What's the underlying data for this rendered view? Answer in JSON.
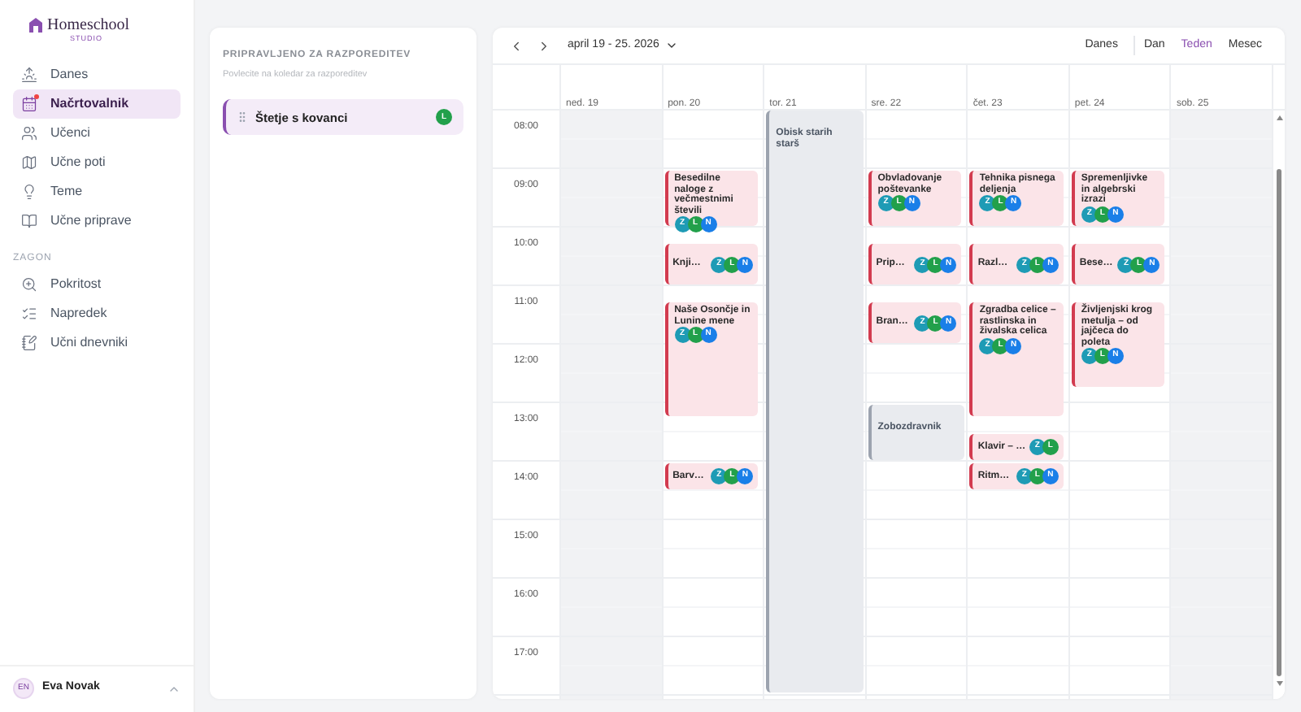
{
  "sidebar": {
    "logo": {
      "name": "Homeschool",
      "tagline": "STUDIO"
    },
    "items": [
      {
        "label": "Danes",
        "selected": false,
        "badge": false
      },
      {
        "label": "Načrtovalnik",
        "selected": true,
        "badge": true
      },
      {
        "label": "Učenci",
        "selected": false,
        "badge": false
      },
      {
        "label": "Učne poti",
        "selected": false,
        "badge": false
      },
      {
        "label": "Teme",
        "selected": false,
        "badge": false
      },
      {
        "label": "Učne priprave",
        "selected": false,
        "badge": false
      }
    ],
    "section": "ZAGON",
    "section_items": [
      {
        "label": "Pokritost",
        "selected": false,
        "badge": false
      },
      {
        "label": "Napredek",
        "selected": false,
        "badge": false
      },
      {
        "label": "Učni dnevniki",
        "selected": false,
        "badge": false
      }
    ],
    "user": {
      "initials": "EN",
      "name": "Eva Novak"
    }
  },
  "backlog": {
    "title": "PRIPRAVLJENO ZA RAZPOREDITEV",
    "hint": "Povlecite na koledar za razporeditev",
    "items": [
      {
        "title": "Štetje s kovanci",
        "students": [
          {
            "letter": "L",
            "color": "#22a04b"
          }
        ]
      }
    ]
  },
  "calendar": {
    "range": "april 19 - 25. 2026",
    "views": [
      {
        "label": "Danes",
        "selected": false
      },
      {
        "label": "Dan",
        "selected": false
      },
      {
        "label": "Teden",
        "selected": true
      },
      {
        "label": "Mesec",
        "selected": false
      }
    ],
    "hours": [
      "08:00",
      "09:00",
      "10:00",
      "11:00",
      "12:00",
      "13:00",
      "14:00",
      "15:00",
      "16:00",
      "17:00"
    ],
    "days": [
      {
        "label": "ned. 19",
        "weekend": true
      },
      {
        "label": "pon. 20",
        "weekend": false,
        "events": [
          {
            "kind": "lesson",
            "title": "Besedilne naloge z večmestnimi števili",
            "students": [
              {
                "letter": "Z",
                "color": "#1e9bb5"
              },
              {
                "letter": "L",
                "color": "#22a04b"
              },
              {
                "letter": "N",
                "color": "#1a7fe8"
              }
            ]
          },
          {
            "kind": "lesson",
            "title": "Knji…",
            "students": [
              {
                "letter": "Z",
                "color": "#1e9bb5"
              },
              {
                "letter": "L",
                "color": "#22a04b"
              },
              {
                "letter": "N",
                "color": "#1a7fe8"
              }
            ]
          },
          {
            "kind": "lesson",
            "title": "Naše Osončje in Lunine mene",
            "students": [
              {
                "letter": "Z",
                "color": "#1e9bb5"
              },
              {
                "letter": "L",
                "color": "#22a04b"
              },
              {
                "letter": "N",
                "color": "#1a7fe8"
              }
            ]
          },
          {
            "kind": "lesson",
            "title": "Barv…",
            "students": [
              {
                "letter": "Z",
                "color": "#1e9bb5"
              },
              {
                "letter": "L",
                "color": "#22a04b"
              },
              {
                "letter": "N",
                "color": "#1a7fe8"
              }
            ]
          }
        ]
      },
      {
        "label": "tor. 21",
        "weekend": false,
        "events": [
          {
            "kind": "personal",
            "title": "Obisk starih starš"
          }
        ]
      },
      {
        "label": "sre. 22",
        "weekend": false,
        "events": [
          {
            "kind": "lesson",
            "title": "Obvladovanje poštevanke",
            "students": [
              {
                "letter": "Z",
                "color": "#1e9bb5"
              },
              {
                "letter": "L",
                "color": "#22a04b"
              },
              {
                "letter": "N",
                "color": "#1a7fe8"
              }
            ]
          },
          {
            "kind": "lesson",
            "title": "Prip…",
            "students": [
              {
                "letter": "Z",
                "color": "#1e9bb5"
              },
              {
                "letter": "L",
                "color": "#22a04b"
              },
              {
                "letter": "N",
                "color": "#1a7fe8"
              }
            ]
          },
          {
            "kind": "lesson",
            "title": "Bran…",
            "students": [
              {
                "letter": "Z",
                "color": "#1e9bb5"
              },
              {
                "letter": "L",
                "color": "#22a04b"
              },
              {
                "letter": "N",
                "color": "#1a7fe8"
              }
            ]
          },
          {
            "kind": "personal",
            "title": "Zobozdravnik"
          }
        ]
      },
      {
        "label": "čet. 23",
        "weekend": false,
        "events": [
          {
            "kind": "lesson",
            "title": "Tehnika pisnega deljenja",
            "students": [
              {
                "letter": "Z",
                "color": "#1e9bb5"
              },
              {
                "letter": "L",
                "color": "#22a04b"
              },
              {
                "letter": "N",
                "color": "#1a7fe8"
              }
            ]
          },
          {
            "kind": "lesson",
            "title": "Razl…",
            "students": [
              {
                "letter": "Z",
                "color": "#1e9bb5"
              },
              {
                "letter": "L",
                "color": "#22a04b"
              },
              {
                "letter": "N",
                "color": "#1a7fe8"
              }
            ]
          },
          {
            "kind": "lesson",
            "title": "Zgradba celice – rastlinska in živalska celica",
            "students": [
              {
                "letter": "Z",
                "color": "#1e9bb5"
              },
              {
                "letter": "L",
                "color": "#22a04b"
              },
              {
                "letter": "N",
                "color": "#1a7fe8"
              }
            ]
          },
          {
            "kind": "lesson",
            "title": "Klavir – …",
            "students": [
              {
                "letter": "Z",
                "color": "#1e9bb5"
              },
              {
                "letter": "L",
                "color": "#22a04b"
              }
            ]
          },
          {
            "kind": "lesson",
            "title": "Ritm…",
            "students": [
              {
                "letter": "Z",
                "color": "#1e9bb5"
              },
              {
                "letter": "L",
                "color": "#22a04b"
              },
              {
                "letter": "N",
                "color": "#1a7fe8"
              }
            ]
          }
        ]
      },
      {
        "label": "pet. 24",
        "weekend": false,
        "events": [
          {
            "kind": "lesson",
            "title": "Spremenljivke in algebrski izrazi",
            "students": [
              {
                "letter": "Z",
                "color": "#1e9bb5"
              },
              {
                "letter": "L",
                "color": "#22a04b"
              },
              {
                "letter": "N",
                "color": "#1a7fe8"
              }
            ]
          },
          {
            "kind": "lesson",
            "title": "Bese…",
            "students": [
              {
                "letter": "Z",
                "color": "#1e9bb5"
              },
              {
                "letter": "L",
                "color": "#22a04b"
              },
              {
                "letter": "N",
                "color": "#1a7fe8"
              }
            ]
          },
          {
            "kind": "lesson",
            "title": "Življenjski krog metulja – od jajčeca do poleta",
            "students": [
              {
                "letter": "Z",
                "color": "#1e9bb5"
              },
              {
                "letter": "L",
                "color": "#22a04b"
              },
              {
                "letter": "N",
                "color": "#1a7fe8"
              }
            ]
          }
        ]
      },
      {
        "label": "sob. 25",
        "weekend": true
      }
    ]
  }
}
